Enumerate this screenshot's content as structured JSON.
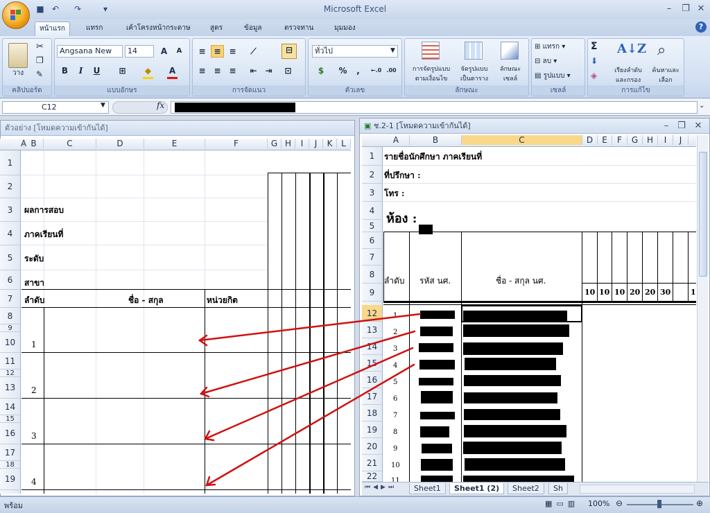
{
  "app": {
    "title": "Microsoft Excel"
  },
  "ribbon_tabs": [
    "หน้าแรก",
    "แทรก",
    "เค้าโครงหน้ากระดาษ",
    "สูตร",
    "ข้อมูล",
    "ตรวจทาน",
    "มุมมอง"
  ],
  "ribbon": {
    "clipboard": {
      "paste": "วาง",
      "group": "คลิปบอร์ด"
    },
    "font": {
      "name": "Angsana New",
      "size": "14",
      "group": "แบบอักษร",
      "bold": "B",
      "italic": "I",
      "underline": "U",
      "grow": "A",
      "shrink": "A"
    },
    "alignment": {
      "group": "การจัดแนว"
    },
    "number": {
      "format": "ทั่วไป",
      "percent": "%",
      "comma": ",",
      "inc": "←.0",
      "dec": ".00",
      "group": "ตัวเลข"
    },
    "styles": {
      "cond_format": "การจัดรูปแบบ\nตามเงื่อนไข",
      "table": "จัดรูปแบบ\nเป็นตาราง",
      "cell_styles": "ลักษณะ\nเซลล์",
      "group": "ลักษณะ"
    },
    "cells": {
      "insert": "แทรก",
      "delete": "ลบ",
      "format": "รูปแบบ",
      "group": "เซลล์"
    },
    "editing": {
      "sigma": "Σ",
      "sort": "เรียงลำดับ\nและกรอง",
      "find": "ค้นหาและ\nเลือก",
      "group": "การแก้ไข"
    }
  },
  "formula_bar": {
    "name_box": "C12",
    "fx": "fx"
  },
  "left_window": {
    "title": "ตัวอย่าง  [โหมดความเข้ากันได้]",
    "columns": [
      "A",
      "B",
      "C",
      "D",
      "E",
      "F",
      "G",
      "H",
      "I",
      "J",
      "K",
      "L"
    ],
    "rows": [
      "1",
      "2",
      "3",
      "4",
      "5",
      "6",
      "7",
      "8",
      "9",
      "10",
      "11",
      "12",
      "13",
      "14",
      "15",
      "16",
      "17",
      "18",
      "19"
    ],
    "cells": {
      "r3": "ผลการสอบ",
      "r4": "ภาคเรียนที่",
      "r5": "ระดับ",
      "r6": "สาขา",
      "h_order": "ลำดับ",
      "h_name": "ชื่อ  -  สกุล",
      "h_credit": "หน่วยกิต",
      "n1": "1",
      "n2": "2",
      "n3": "3",
      "n4": "4"
    }
  },
  "right_window": {
    "title": "ช.2-1  [โหมดความเข้ากันได้]",
    "columns": [
      "A",
      "B",
      "C",
      "D",
      "E",
      "F",
      "G",
      "H",
      "I",
      "J"
    ],
    "rows": [
      "1",
      "2",
      "3",
      "4",
      "5",
      "6",
      "7",
      "8",
      "9",
      "12",
      "13",
      "14",
      "15",
      "16",
      "17",
      "18",
      "19",
      "20",
      "21",
      "22"
    ],
    "cells": {
      "r1": "รายชื่อนักศึกษา ภาคเรียนที่",
      "r2": "ที่ปรึกษา :",
      "r3": "โทร :",
      "r4": "ห้อง :",
      "h_order": "ลำดับ",
      "h_id": "รหัส นศ.",
      "h_name": "ชื่อ - สกุล นศ.",
      "scores": [
        "10",
        "10",
        "10",
        "20",
        "20",
        "30",
        "1"
      ],
      "nums": [
        "1",
        "2",
        "3",
        "4",
        "5",
        "6",
        "7",
        "8",
        "9",
        "10",
        "11"
      ]
    },
    "sheet_tabs": [
      "Sheet1",
      "Sheet1 (2)",
      "Sheet2",
      "Sh"
    ]
  },
  "status": {
    "ready": "พร้อม",
    "zoom": "100%"
  },
  "colors": {
    "arrow": "#d01010",
    "accent": "#f3a51a"
  }
}
